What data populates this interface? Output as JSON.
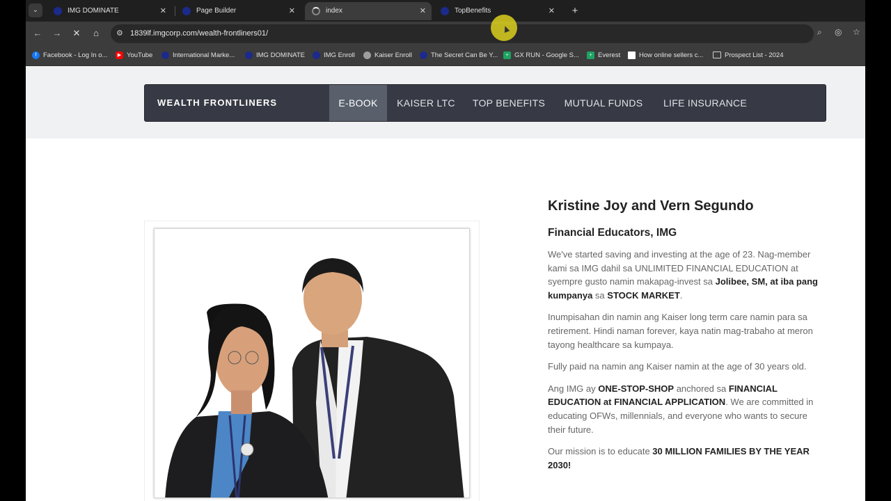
{
  "tabs": [
    {
      "title": "IMG DOMINATE",
      "active": false
    },
    {
      "title": "Page Builder",
      "active": false
    },
    {
      "title": "index",
      "active": true
    },
    {
      "title": "TopBenefits",
      "active": false
    }
  ],
  "tab_close_glyph": "✕",
  "new_tab_glyph": "+",
  "address": {
    "url": "1839lf.imgcorp.com/wealth-frontliners01/"
  },
  "bookmarks": [
    {
      "label": "Facebook - Log In o...",
      "icon": "facebook-icon",
      "color": "#1877f2"
    },
    {
      "label": "YouTube",
      "icon": "youtube-icon",
      "color": "#ff0000"
    },
    {
      "label": "International Marke...",
      "icon": "img-logo-icon",
      "color": "#1c2a8c"
    },
    {
      "label": "IMG DOMINATE",
      "icon": "img-logo-icon",
      "color": "#1c2a8c"
    },
    {
      "label": "IMG Enroll",
      "icon": "img-logo-icon",
      "color": "#1c2a8c"
    },
    {
      "label": "Kaiser Enroll",
      "icon": "globe-icon",
      "color": "#9e9e9e"
    },
    {
      "label": "The Secret Can Be Y...",
      "icon": "img-logo-icon",
      "color": "#1c2a8c"
    },
    {
      "label": "GX RUN - Google S...",
      "icon": "sheets-icon",
      "color": "#1ea362"
    },
    {
      "label": "Everest",
      "icon": "sheets-icon",
      "color": "#1ea362"
    },
    {
      "label": "How online sellers c...",
      "icon": "page-icon",
      "color": "#ffffff"
    },
    {
      "label": "Prospect List - 2024",
      "icon": "folder-icon",
      "color": "#cfcfcf"
    }
  ],
  "site": {
    "brand": "WEALTH FRONTLINERS",
    "nav": [
      "E-BOOK",
      "KAISER LTC",
      "TOP BENEFITS",
      "MUTUAL FUNDS",
      "LIFE INSURANCE"
    ],
    "active_nav": "E-BOOK"
  },
  "bio": {
    "name": "Kristine Joy and Vern Segundo",
    "role": "Financial Educators, IMG",
    "p1_a": "We've started saving and investing at the age of 23. Nag-member kami sa IMG dahil sa UNLIMITED FINANCIAL EDUCATION at syempre gusto namin makapag-invest sa ",
    "p1_b": "Jolibee, SM, at iba pang kumpanya",
    "p1_c": " sa ",
    "p1_d": "STOCK MARKET",
    "p1_e": ".",
    "p2": "Inumpisahan din namin ang Kaiser long term care namin para sa retirement. Hindi naman forever, kaya natin mag-trabaho at meron tayong healthcare sa kumpaya.",
    "p3": "Fully paid na namin ang Kaiser namin at the age of 30 years old.",
    "p4_a": "Ang IMG ay ",
    "p4_b": "ONE-STOP-SHOP",
    "p4_c": " anchored sa ",
    "p4_d": "FINANCIAL EDUCATION at FINANCIAL APPLICATION",
    "p4_e": ". We are committed in educating OFWs, millennials, and everyone who wants to secure their future.",
    "p5_a": "Our mission is to educate ",
    "p5_b": "30 MILLION FAMILIES BY THE YEAR 2030!"
  },
  "colors": {
    "navbar": "#373a44",
    "nav_active": "#59606c",
    "hero_band": "#eff1f3",
    "cursor_highlight": "#e2d61e"
  }
}
